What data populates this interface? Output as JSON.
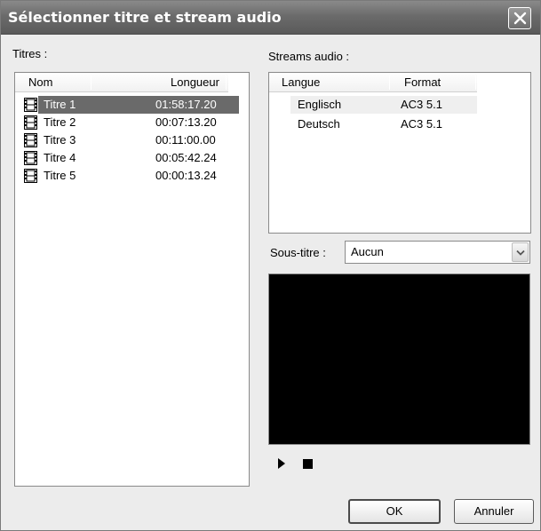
{
  "window": {
    "title": "Sélectionner titre et stream audio"
  },
  "titles": {
    "label": "Titres :",
    "columns": {
      "name": "Nom",
      "duration": "Longueur"
    },
    "items": [
      {
        "name": "Titre 1",
        "duration": "01:58:17.20",
        "selected": true
      },
      {
        "name": "Titre 2",
        "duration": "00:07:13.20",
        "selected": false
      },
      {
        "name": "Titre 3",
        "duration": "00:11:00.00",
        "selected": false
      },
      {
        "name": "Titre 4",
        "duration": "00:05:42.24",
        "selected": false
      },
      {
        "name": "Titre 5",
        "duration": "00:00:13.24",
        "selected": false
      }
    ]
  },
  "audio": {
    "label": "Streams audio :",
    "columns": {
      "language": "Langue",
      "format": "Format"
    },
    "items": [
      {
        "language": "Englisch",
        "format": "AC3 5.1",
        "selected": true
      },
      {
        "language": "Deutsch",
        "format": "AC3 5.1",
        "selected": false
      }
    ]
  },
  "subtitle": {
    "label": "Sous-titre :",
    "value": "Aucun"
  },
  "buttons": {
    "ok": "OK",
    "cancel": "Annuler"
  },
  "icons": {
    "close": "close-icon",
    "play": "play-icon",
    "stop": "stop-icon",
    "film": "film-strip-icon",
    "dropdown": "chevron-down-icon"
  },
  "colors": {
    "titlebar": "#6b6b6b",
    "selection": "#6a6a6a",
    "dialog_bg": "#ececec",
    "preview_bg": "#000000"
  }
}
